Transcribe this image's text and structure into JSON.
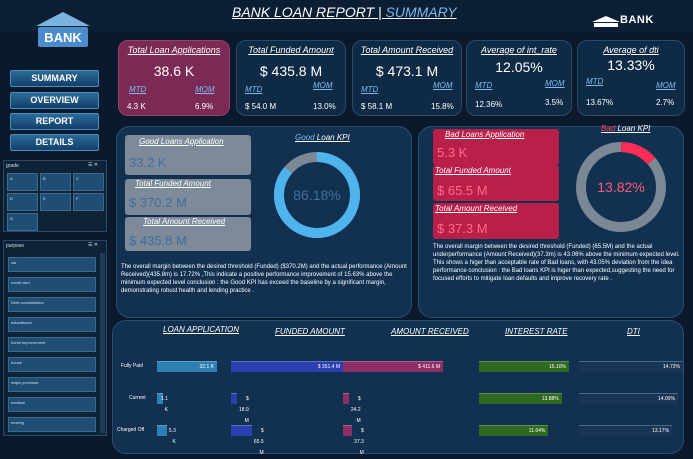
{
  "header": {
    "title": "BANK LOAN REPORT | ",
    "subtitle": "SUMMARY",
    "logo_text": "BANK",
    "brand": "BANK"
  },
  "nav": [
    "SUMMARY",
    "OVERVIEW",
    "REPORT",
    "DETAILS"
  ],
  "grade": {
    "title": "grade",
    "items": [
      "A",
      "B",
      "C",
      "D",
      "E",
      "F",
      "G"
    ]
  },
  "purpose": {
    "title": "purpose",
    "items": [
      "car",
      "credit card",
      "Debt consolidation",
      "educational",
      "home improvement",
      "house",
      "major purchase",
      "medical",
      "moving"
    ]
  },
  "kpis": [
    {
      "title": "Total Loan Applications",
      "value": "38.6 K",
      "mtd": "4.3 K",
      "mom": "6.9%"
    },
    {
      "title": "Total Funded Amount",
      "value": "$ 435.8 M",
      "mtd": "$ 54.0 M",
      "mom": "13.0%"
    },
    {
      "title": "Total Amount Received",
      "value": "$ 473.1 M",
      "mtd": "$ 58.1 M",
      "mom": "15.8%"
    },
    {
      "title": "Average of int_rate",
      "value": "12.05%",
      "mtd": "12.36%",
      "mom": "3.5%"
    },
    {
      "title": "Average of dti",
      "value": "13.33%",
      "mtd": "13.67%",
      "mom": "2.7%"
    }
  ],
  "labels": {
    "mtd": "MTD",
    "mom": "MOM"
  },
  "good": {
    "apps_label": "Good Loans Application",
    "apps": "33.2 K",
    "funded_label": "Total Funded Amount",
    "funded": "$ 370.2 M",
    "recv_label": "Total Amount Received",
    "recv": "$ 435.8 M",
    "kpi_label_a": "Good",
    "kpi_label_b": " Loan KPI",
    "kpi": "86.18%",
    "kpi_fraction": 0.8618,
    "desc": "The overall margin between the desired threshold (Funded) ($370.2M) and the actual performance (Amount Received)(435.8m) is 17.72% ,This indicate a positive performance improvement of 15.63% above the minimum expected level conclusion : the Good KPI has exceed the baseline by a significant margin, demonstrating robust health and lending practice ."
  },
  "bad": {
    "apps_label": "Bad Loans Application",
    "apps": "5.3 K",
    "funded_label": "Total Funded Amount",
    "funded": "$ 65.5 M",
    "recv_label": "Total Amount Received",
    "recv": "$ 37.3 M",
    "kpi_label_a": "Bad",
    "kpi_label_b": " Loan KPI",
    "kpi": "13.82%",
    "kpi_fraction": 0.1382,
    "desc": "The overall margin between the desired threshold (Funded) (65.5M) and the actual underperformance (Amount Received)(37.3m) is 43.06% above the minimum expected level. This shows a higer than acceptable rate of Bad loans, with 43.05% deviation from the idea performance conclusion : the Bad loans KPI is higer than expected,suggesting the need for focused efforts to mitigate loan defaults and improve recovery rate ."
  },
  "table": {
    "headers": [
      "LOAN APPLICATION",
      "FUNDED AMOUNT",
      "AMOUNT RECEIVED",
      "INTEREST RATE",
      "DTI"
    ],
    "rows": [
      {
        "label": "Fully Paid",
        "apps": "32.1 K",
        "funded": "$ 351.4 M",
        "recv": "$ 411.6 M",
        "int": "15.10%",
        "dti": "14.72%"
      },
      {
        "label": "Current",
        "apps": "1.1 K",
        "funded": "$ 18.9 M",
        "recv": "$ 24.2 M",
        "int": "13.88%",
        "dti": "14.00%"
      },
      {
        "label": "Charged Off",
        "apps": "5.3 K",
        "funded": "$ 65.5 M",
        "recv": "$ 37.3 M",
        "int": "11.64%",
        "dti": "13.17%"
      }
    ]
  }
}
